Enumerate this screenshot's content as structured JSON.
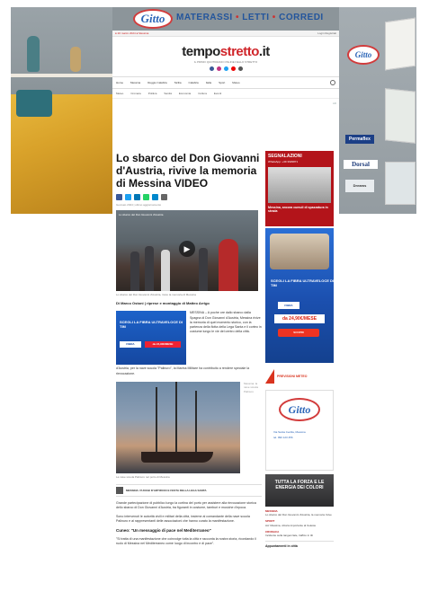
{
  "skin": {
    "brand_logo": "Gitto",
    "brand_tagline_parts": [
      "MATERASSI",
      "LETTI",
      "CORREDI"
    ],
    "separator": "•",
    "right_logo": "Gitto",
    "right_badges": [
      "Permaflex",
      "Dorsal",
      "Dreams"
    ]
  },
  "site": {
    "topbar_left": "● 20 marzo 2024  ● Messina",
    "topbar_right": "Login   Registrati",
    "logo_main": "tempo",
    "logo_accent": "stretto",
    "logo_tld": ".it",
    "logo_sub": "IL PRIMO QUOTIDIANO ONLINE DELLO STRETTO",
    "nav_items": [
      "Home",
      "Messina",
      "Reggio Calabria",
      "Sicilia",
      "Calabria",
      "Italia",
      "Sport",
      "Meteo"
    ],
    "subnav_items": [
      "Meteo",
      "Cronaca",
      "Politica",
      "Sanità",
      "Economia",
      "Cultura",
      "Eventi"
    ],
    "ad_marker": "AD"
  },
  "article": {
    "headline": "Lo sbarco del Don Giovanni d'Austria, rivive la memoria di Messina VIDEO",
    "byline": "Gennaio 2024 | ultimo aggiornamento",
    "video_title": "Lo sbarco del Don Giovanni d'Austria",
    "play_symbol": "▶",
    "video_caption": "Lo sbarco del Don Giovanni d'Austria, rivive la memoria di Messina",
    "author": "Di Marco Ostoni | riprese e montaggio di Matteo Arrigo",
    "tim_ad_text": "SCEGLI LA FIBRA ULTRAVELOCE DI TIM",
    "tim_ad_button": "FIBRA",
    "tim_ad_price": "da 24,90€/MESE",
    "para1": "MESSINA – A poche ore dallo sbarco dalla Spagna di Don Giovanni d'Austria, Messina rivive la memoria di quel momento storico, con la partenza della flotta della Lega Santa e il corteo in costume lungo le vie del centro della città.",
    "para1_tail": "d'Austria, per la nave scuola \"Palinuro\", la Marina Militare ha contribuito a rendere speciale la rievocazione.",
    "ship_side_caption": "Messina: la nave scuola Palinuro",
    "ship_caption": "La nave scuola Palinuro nel porto di Messina",
    "related_text": "MESSINA: FUOCHI D'ARTIFICIO E FESTA DELLA LEGA SANTA",
    "para2": "Grande partecipazione di pubblico lungo la cortina del porto per assistere alla rievocazione storica dello sbarco di Don Giovanni d'Austria, tra figuranti in costume, tamburi e musiche d'epoca.",
    "para3": "Sono intervenuti le autorità civili e militari della città, insieme al comandante della nave scuola Palinuro e ai rappresentanti delle associazioni che hanno curato la manifestazione.",
    "subhead": "Cuneo: \"Un messaggio di pace nel Mediterraneo\"",
    "para4": "\"Si tratta di una manifestazione che coinvolge tutta la città e racconta la nostra storia, ricordando il ruolo di Messina nel Mediterraneo come luogo di incontro e di pace\"."
  },
  "sidebar": {
    "seg_title": "SEGNALAZIONI",
    "seg_sub": "WhatsApp: +39 3929871",
    "seg_text": "Messina, ancora cumuli di spazzatura in strada",
    "tim_heading": "SCEGLI LA FIBRA ULTRAVELOCE DI TIM",
    "tim_fibra": "FIBRA",
    "tim_price": "da 24,90€/MESE",
    "tim_cta": "SCOPRI",
    "meteo_label": "PREVISIONI METEO",
    "side_logo": "Gitto",
    "side_logo_lines": [
      "Via Santa Cecilia, Messina",
      "tel. 090 123 456"
    ],
    "dark_box": "TUTTA LA FORZA E LE ENERGIA DEI COLORI",
    "news": [
      {
        "cat": "MESSINA",
        "text": "Lo sbarco del Don Giovanni d'Austria, la memoria rivive"
      },
      {
        "cat": "SPORT",
        "text": "Acr Messina, vittoria importante al Celeste"
      },
      {
        "cat": "CRONACA",
        "text": "Incidente sulla tangenziale, traffico in tilt"
      }
    ],
    "appuntamento": "Appuntamenti in città"
  }
}
